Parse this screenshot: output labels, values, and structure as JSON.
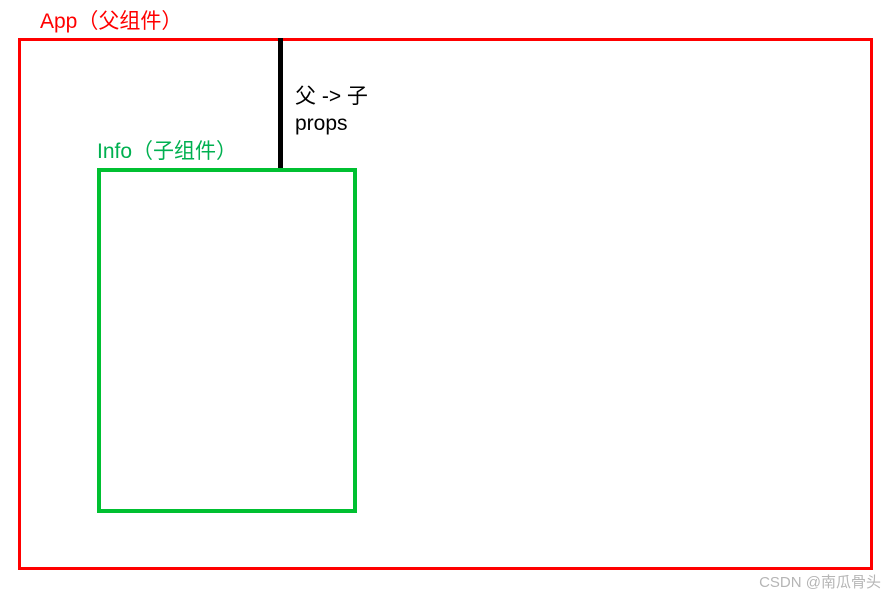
{
  "diagram": {
    "parent_label": "App（父组件）",
    "child_label": "Info（子组件）",
    "arrow_text_1": "父 -> 子",
    "arrow_text_2": "props"
  },
  "watermark": "CSDN @南瓜骨头",
  "colors": {
    "parent_border": "#ff0000",
    "child_border": "#00c031",
    "child_text": "#00b050",
    "arrow": "#000000"
  }
}
